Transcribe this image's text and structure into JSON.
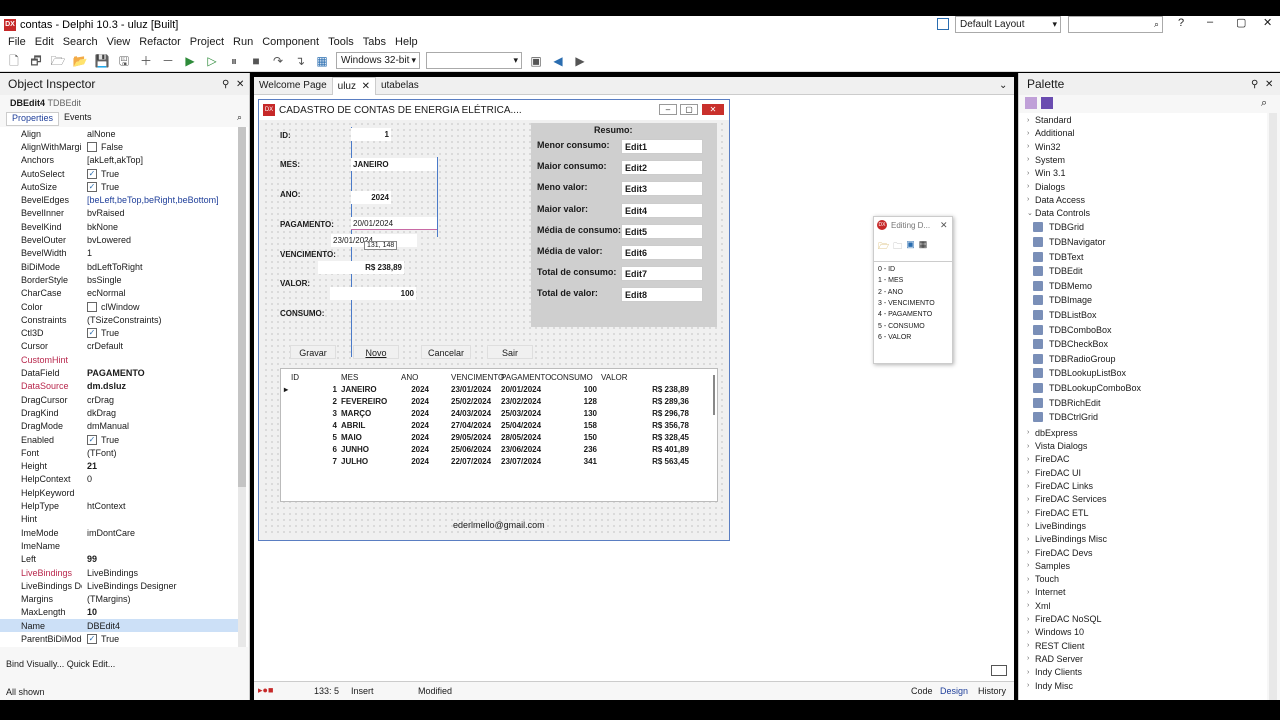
{
  "window": {
    "title": "contas - Delphi 10.3 - uluz [Built]",
    "icon": "DX"
  },
  "menu": [
    "File",
    "Edit",
    "Search",
    "View",
    "Refactor",
    "Project",
    "Run",
    "Component",
    "Tools",
    "Tabs",
    "Help"
  ],
  "title_right": {
    "layout_combo": "Default Layout"
  },
  "toolbar": {
    "platform": "Windows 32-bit",
    "config": ""
  },
  "object_inspector": {
    "title": "Object Inspector",
    "component": "DBEdit4",
    "component_type": "TDBEdit",
    "tabs": [
      "Properties",
      "Events"
    ],
    "footer_links": "Bind Visually... Quick Edit...",
    "footer_status": "All shown",
    "props": [
      {
        "n": "Align",
        "v": "alNone"
      },
      {
        "n": "AlignWithMargi",
        "v": "False",
        "cb": true,
        "checked": false
      },
      {
        "n": "Anchors",
        "v": "[akLeft,akTop]"
      },
      {
        "n": "AutoSelect",
        "v": "True",
        "cb": true,
        "checked": true
      },
      {
        "n": "AutoSize",
        "v": "True",
        "cb": true,
        "checked": true
      },
      {
        "n": "BevelEdges",
        "v": "[beLeft,beTop,beRight,beBottom]",
        "blue": true
      },
      {
        "n": "BevelInner",
        "v": "bvRaised"
      },
      {
        "n": "BevelKind",
        "v": "bkNone"
      },
      {
        "n": "BevelOuter",
        "v": "bvLowered"
      },
      {
        "n": "BevelWidth",
        "v": "1"
      },
      {
        "n": "BiDiMode",
        "v": "bdLeftToRight"
      },
      {
        "n": "BorderStyle",
        "v": "bsSingle"
      },
      {
        "n": "CharCase",
        "v": "ecNormal"
      },
      {
        "n": "Color",
        "v": "clWindow",
        "cb": true,
        "checked": false
      },
      {
        "n": "Constraints",
        "v": "(TSizeConstraints)"
      },
      {
        "n": "Ctl3D",
        "v": "True",
        "cb": true,
        "checked": true
      },
      {
        "n": "Cursor",
        "v": "crDefault"
      },
      {
        "n": "CustomHint",
        "v": "",
        "red": true
      },
      {
        "n": "DataField",
        "v": "PAGAMENTO",
        "bold": true
      },
      {
        "n": "DataSource",
        "v": "dm.dsluz",
        "red": true,
        "bold": true
      },
      {
        "n": "DragCursor",
        "v": "crDrag"
      },
      {
        "n": "DragKind",
        "v": "dkDrag"
      },
      {
        "n": "DragMode",
        "v": "dmManual"
      },
      {
        "n": "Enabled",
        "v": "True",
        "cb": true,
        "checked": true
      },
      {
        "n": "Font",
        "v": "(TFont)"
      },
      {
        "n": "Height",
        "v": "21",
        "bold": true
      },
      {
        "n": "HelpContext",
        "v": "0"
      },
      {
        "n": "HelpKeyword",
        "v": ""
      },
      {
        "n": "HelpType",
        "v": "htContext"
      },
      {
        "n": "Hint",
        "v": ""
      },
      {
        "n": "ImeMode",
        "v": "imDontCare"
      },
      {
        "n": "ImeName",
        "v": ""
      },
      {
        "n": "Left",
        "v": "99",
        "bold": true
      },
      {
        "n": "LiveBindings",
        "v": "LiveBindings",
        "red": true
      },
      {
        "n": "LiveBindings De",
        "v": "LiveBindings Designer"
      },
      {
        "n": "Margins",
        "v": "(TMargins)"
      },
      {
        "n": "MaxLength",
        "v": "10",
        "bold": true
      },
      {
        "n": "Name",
        "v": "DBEdit4",
        "sel": true
      },
      {
        "n": "ParentBiDiMode",
        "v": "True",
        "cb": true,
        "checked": true
      }
    ]
  },
  "editor_tabs": [
    "Welcome Page",
    "uluz",
    "utabelas"
  ],
  "form": {
    "title": "CADASTRO DE CONTAS DE ENERGIA ELÉTRICA....",
    "labels": [
      "ID:",
      "MES:",
      "ANO:",
      "PAGAMENTO:",
      "VENCIMENTO:",
      "VALOR:",
      "CONSUMO:"
    ],
    "edit_id": "1",
    "edit_mes": "JANEIRO",
    "edit_ano": "2024",
    "edit_pagamento": "20/01/2024",
    "edit_vencimento": "23/01/2024",
    "edit_valor": "R$ 238,89",
    "edit_consumo": "100",
    "tooltip": "131, 148",
    "buttons": [
      "Gravar",
      "Novo",
      "Cancelar",
      "Sair"
    ],
    "footer": "ederlmello@gmail.com",
    "resumo": {
      "title": "Resumo:",
      "rows": [
        {
          "label": "Menor consumo:",
          "edit": "Edit1"
        },
        {
          "label": "Maior consumo:",
          "edit": "Edit2"
        },
        {
          "label": "Meno valor:",
          "edit": "Edit3"
        },
        {
          "label": "Maior valor:",
          "edit": "Edit4"
        },
        {
          "label": "Média de consumo:",
          "edit": "Edit5"
        },
        {
          "label": "Média de valor:",
          "edit": "Edit6"
        },
        {
          "label": "Total de consumo:",
          "edit": "Edit7"
        },
        {
          "label": "Total de valor:",
          "edit": "Edit8"
        }
      ]
    },
    "grid": {
      "columns": [
        "ID",
        "MES",
        "ANO",
        "VENCIMENTO",
        "PAGAMENTO",
        "CONSUMO",
        "VALOR"
      ],
      "rows": [
        [
          "1",
          "JANEIRO",
          "2024",
          "23/01/2024",
          "20/01/2024",
          "100",
          "R$ 238,89"
        ],
        [
          "2",
          "FEVEREIRO",
          "2024",
          "25/02/2024",
          "23/02/2024",
          "128",
          "R$ 289,36"
        ],
        [
          "3",
          "MARÇO",
          "2024",
          "24/03/2024",
          "25/03/2024",
          "130",
          "R$ 296,78"
        ],
        [
          "4",
          "ABRIL",
          "2024",
          "27/04/2024",
          "25/04/2024",
          "158",
          "R$ 356,78"
        ],
        [
          "5",
          "MAIO",
          "2024",
          "29/05/2024",
          "28/05/2024",
          "150",
          "R$ 328,45"
        ],
        [
          "6",
          "JUNHO",
          "2024",
          "25/06/2024",
          "23/06/2024",
          "236",
          "R$ 401,89"
        ],
        [
          "7",
          "JULHO",
          "2024",
          "22/07/2024",
          "23/07/2024",
          "341",
          "R$ 563,45"
        ]
      ]
    }
  },
  "fields_editor": {
    "title": "Editing D...",
    "items": [
      "0 - ID",
      "1 - MES",
      "2 - ANO",
      "3 - VENCIMENTO",
      "4 - PAGAMENTO",
      "5 - CONSUMO",
      "6 - VALOR"
    ]
  },
  "status_bar": {
    "pos": "133:  5",
    "mode": "Insert",
    "state": "Modified",
    "tabs": [
      "Code",
      "Design",
      "History"
    ]
  },
  "palette": {
    "title": "Palette",
    "before": [
      "Standard",
      "Additional",
      "Win32",
      "System",
      "Win 3.1",
      "Dialogs",
      "Data Access"
    ],
    "expanded": "Data Controls",
    "data_controls": [
      "TDBGrid",
      "TDBNavigator",
      "TDBText",
      "TDBEdit",
      "TDBMemo",
      "TDBImage",
      "TDBListBox",
      "TDBComboBox",
      "TDBCheckBox",
      "TDBRadioGroup",
      "TDBLookupListBox",
      "TDBLookupComboBox",
      "TDBRichEdit",
      "TDBCtrlGrid"
    ],
    "after": [
      "dbExpress",
      "Vista Dialogs",
      "FireDAC",
      "FireDAC UI",
      "FireDAC Links",
      "FireDAC Services",
      "FireDAC ETL",
      "LiveBindings",
      "LiveBindings Misc",
      "FireDAC Devs",
      "Samples",
      "Touch",
      "Internet",
      "Xml",
      "FireDAC NoSQL",
      "Windows 10",
      "REST Client",
      "RAD Server",
      "Indy Clients",
      "Indy Misc"
    ]
  }
}
